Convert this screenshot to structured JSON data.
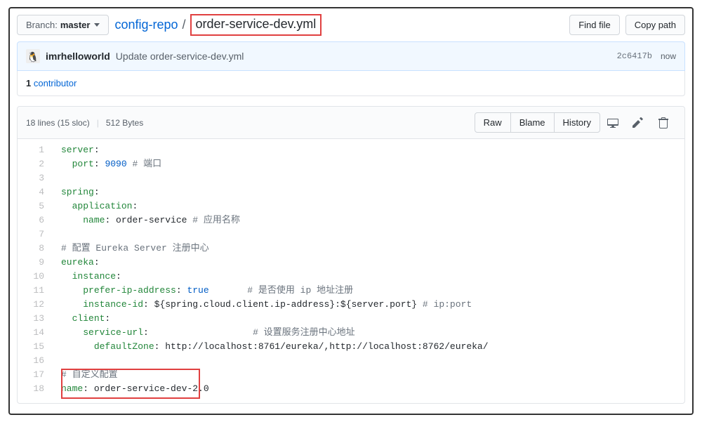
{
  "branch": {
    "label": "Branch:",
    "name": "master"
  },
  "breadcrumb": {
    "repo": "config-repo",
    "sep": "/",
    "file": "order-service-dev.yml"
  },
  "actions": {
    "findFile": "Find file",
    "copyPath": "Copy path"
  },
  "commit": {
    "author": "imrhelloworld",
    "message": "Update order-service-dev.yml",
    "sha": "2c6417b",
    "time": "now"
  },
  "contributors": {
    "count": "1",
    "label": "contributor"
  },
  "fileInfo": {
    "lines": "18 lines (15 sloc)",
    "size": "512 Bytes"
  },
  "fileActions": {
    "raw": "Raw",
    "blame": "Blame",
    "history": "History"
  },
  "code": [
    {
      "n": "1",
      "segs": [
        {
          "c": "pl-key",
          "t": "server"
        },
        {
          "t": ":"
        }
      ]
    },
    {
      "n": "2",
      "segs": [
        {
          "t": "  "
        },
        {
          "c": "pl-key",
          "t": "port"
        },
        {
          "t": ": "
        },
        {
          "c": "pl-num",
          "t": "9090"
        },
        {
          "t": " "
        },
        {
          "c": "pl-com",
          "t": "# 端口"
        }
      ]
    },
    {
      "n": "3",
      "segs": []
    },
    {
      "n": "4",
      "segs": [
        {
          "c": "pl-key",
          "t": "spring"
        },
        {
          "t": ":"
        }
      ]
    },
    {
      "n": "5",
      "segs": [
        {
          "t": "  "
        },
        {
          "c": "pl-key",
          "t": "application"
        },
        {
          "t": ":"
        }
      ]
    },
    {
      "n": "6",
      "segs": [
        {
          "t": "    "
        },
        {
          "c": "pl-key",
          "t": "name"
        },
        {
          "t": ": order-service "
        },
        {
          "c": "pl-com",
          "t": "# 应用名称"
        }
      ]
    },
    {
      "n": "7",
      "segs": []
    },
    {
      "n": "8",
      "segs": [
        {
          "c": "pl-com",
          "t": "# 配置 Eureka Server 注册中心"
        }
      ]
    },
    {
      "n": "9",
      "segs": [
        {
          "c": "pl-key",
          "t": "eureka"
        },
        {
          "t": ":"
        }
      ]
    },
    {
      "n": "10",
      "segs": [
        {
          "t": "  "
        },
        {
          "c": "pl-key",
          "t": "instance"
        },
        {
          "t": ":"
        }
      ]
    },
    {
      "n": "11",
      "segs": [
        {
          "t": "    "
        },
        {
          "c": "pl-key",
          "t": "prefer-ip-address"
        },
        {
          "t": ": "
        },
        {
          "c": "pl-bool",
          "t": "true"
        },
        {
          "t": "       "
        },
        {
          "c": "pl-com",
          "t": "# 是否使用 ip 地址注册"
        }
      ]
    },
    {
      "n": "12",
      "segs": [
        {
          "t": "    "
        },
        {
          "c": "pl-key",
          "t": "instance-id"
        },
        {
          "t": ": ${spring.cloud.client.ip-address}:${server.port} "
        },
        {
          "c": "pl-com",
          "t": "# ip:port"
        }
      ]
    },
    {
      "n": "13",
      "segs": [
        {
          "t": "  "
        },
        {
          "c": "pl-key",
          "t": "client"
        },
        {
          "t": ":"
        }
      ]
    },
    {
      "n": "14",
      "segs": [
        {
          "t": "    "
        },
        {
          "c": "pl-key",
          "t": "service-url"
        },
        {
          "t": ":                   "
        },
        {
          "c": "pl-com",
          "t": "# 设置服务注册中心地址"
        }
      ]
    },
    {
      "n": "15",
      "segs": [
        {
          "t": "      "
        },
        {
          "c": "pl-key",
          "t": "defaultZone"
        },
        {
          "t": ": http://localhost:8761/eureka/,http://localhost:8762/eureka/"
        }
      ]
    },
    {
      "n": "16",
      "segs": []
    },
    {
      "n": "17",
      "segs": [
        {
          "c": "pl-com",
          "t": "# 自定义配置"
        }
      ]
    },
    {
      "n": "18",
      "segs": [
        {
          "c": "pl-key",
          "t": "name"
        },
        {
          "t": ": order-service-dev-2.0"
        }
      ]
    }
  ]
}
